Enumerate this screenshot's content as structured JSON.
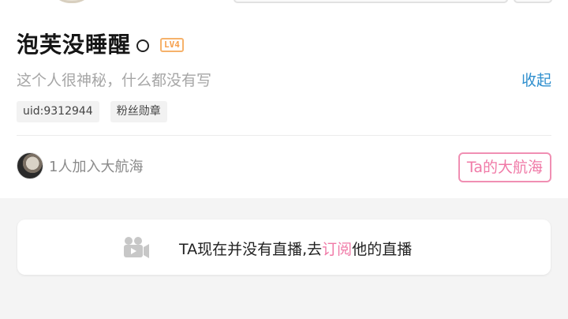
{
  "profile": {
    "name": "泡芙没睡醒",
    "level": "LV4",
    "signature": "这个人很神秘，什么都没有写",
    "collapse_label": "收起",
    "tags": [
      "uid:9312944",
      "粉丝勋章"
    ],
    "fleet_text": "1人加入大航海",
    "fleet_button": "Ta的大航海"
  },
  "live_card": {
    "text_before": "TA现在并没有直播,去",
    "subscribe_link": "订阅",
    "text_after": "他的直播",
    "icon": "video-camera-icon"
  },
  "colors": {
    "accent_pink": "#f07aa7",
    "link_blue": "#2f8fce",
    "level_orange": "#f6a04e"
  }
}
